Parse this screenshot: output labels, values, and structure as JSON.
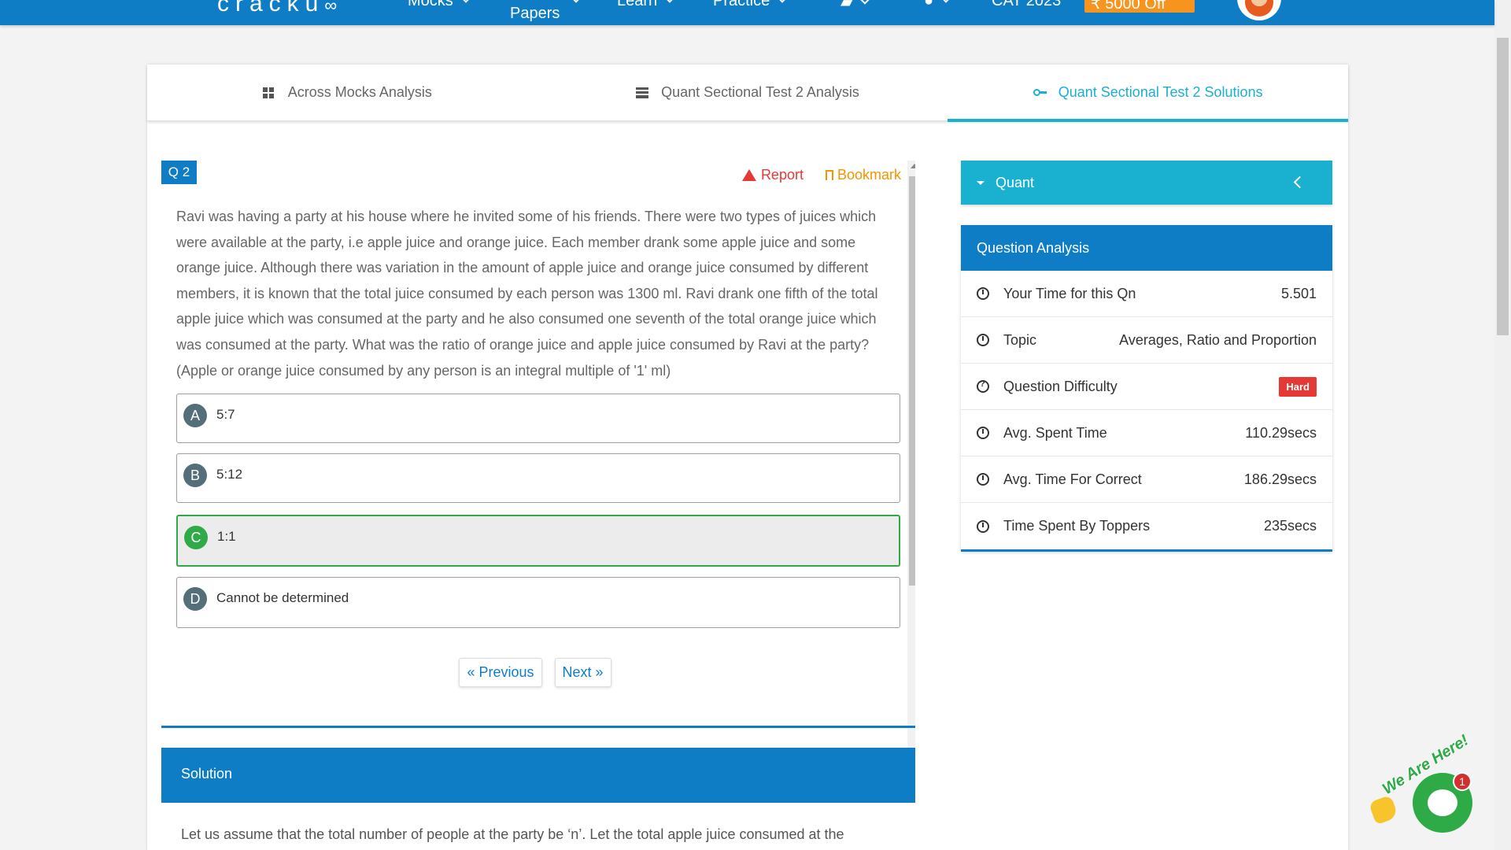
{
  "topnav": {
    "logo": "cracku",
    "items": [
      {
        "label": "Mocks"
      },
      {
        "label": "Papers"
      },
      {
        "label": "Learn"
      },
      {
        "label": "Practice"
      },
      {
        "label": ""
      },
      {
        "label": ""
      },
      {
        "label": "CAT 2023"
      }
    ],
    "offer": "₹ 5000 Off"
  },
  "tabs": [
    {
      "label": "Across Mocks Analysis",
      "icon": "grid-icon"
    },
    {
      "label": "Quant Sectional Test 2 Analysis",
      "icon": "list-icon"
    },
    {
      "label": "Quant Sectional Test 2 Solutions",
      "icon": "key-icon",
      "active": true
    }
  ],
  "question": {
    "badge": "Q 2",
    "report": "Report",
    "bookmark": "Bookmark",
    "text": "Ravi was having a party at his house where he invited some of his friends. There were two types of juices which were available at the party, i.e apple juice and orange juice. Each member drank some apple juice and some orange juice. Although there was variation in the amount of apple juice and orange juice consumed by different members, it is known that the total juice consumed by each person was 1300 ml. Ravi drank one fifth of the total apple juice which was consumed at the party and he also consumed one seventh of the total orange juice which was consumed at the party. What was the ratio of orange juice and apple juice consumed by Ravi at the party? (Apple or orange juice consumed by any person is an integral multiple of '1' ml)",
    "options": [
      {
        "letter": "A",
        "text": "5:7"
      },
      {
        "letter": "B",
        "text": "5:12"
      },
      {
        "letter": "C",
        "text": "1:1",
        "correct": true
      },
      {
        "letter": "D",
        "text": "Cannot be determined"
      }
    ],
    "prev": "« Previous",
    "next": "Next »"
  },
  "solution": {
    "heading": "Solution",
    "text": "Let us assume that the total number of people at the party be ‘n’. Let the total apple juice consumed at the"
  },
  "sidebar": {
    "section": "Quant",
    "analysis_title": "Question Analysis",
    "rows": [
      {
        "label": "Your Time for this Qn",
        "value": "5.501",
        "icon": "stopwatch-icon"
      },
      {
        "label": "Topic",
        "value": "Averages, Ratio and Proportion",
        "icon": "stopwatch-icon"
      },
      {
        "label": "Question Difficulty",
        "value": "Hard",
        "icon": "question-circle-icon"
      },
      {
        "label": "Avg. Spent Time",
        "value": "110.29secs",
        "icon": "clock-icon"
      },
      {
        "label": "Avg. Time For Correct",
        "value": "186.29secs",
        "icon": "alarm-icon"
      },
      {
        "label": "Time Spent By Toppers",
        "value": "235secs",
        "icon": "alarm-icon"
      }
    ]
  },
  "chat": {
    "tagline": "We Are Here!",
    "badge": "1"
  },
  "colors": {
    "primary": "#0f7dc6",
    "accent": "#1ab0cf",
    "correct": "#2eaa47",
    "danger": "#e53935",
    "bookmark": "#f59300"
  }
}
